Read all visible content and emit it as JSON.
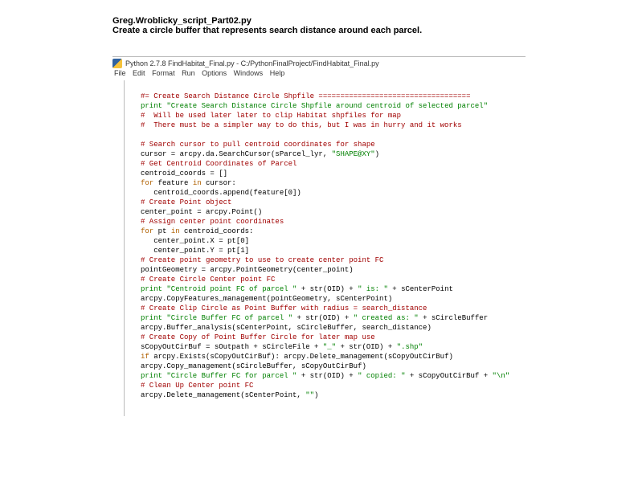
{
  "heading": {
    "filename": "Greg.Wroblicky_script_Part02.py",
    "subtitle": "Create a circle buffer that represents search distance around each parcel."
  },
  "ide": {
    "titlebar": "Python 2.7.8 FindHabitat_Final.py - C:/PythonFinalProject/FindHabitat_Final.py",
    "menu": [
      "File",
      "Edit",
      "Format",
      "Run",
      "Options",
      "Windows",
      "Help"
    ]
  },
  "code_lines": [
    [
      {
        "c": "red",
        "t": "#= Create Search Distance Circle Shpfile ==================================="
      }
    ],
    [
      {
        "c": "green",
        "t": "print "
      },
      {
        "c": "green",
        "t": "\"Create Search Distance Circle Shpfile around centroid of selected parcel\""
      }
    ],
    [
      {
        "c": "red",
        "t": "#  Will be used later later to clip Habitat shpfiles for map"
      }
    ],
    [
      {
        "c": "red",
        "t": "#  There must be a simpler way to do this, but I was in hurry and it works"
      }
    ],
    [],
    [
      {
        "c": "red",
        "t": "# Search cursor to pull centroid coordinates for shape"
      }
    ],
    [
      {
        "c": "black",
        "t": "cursor = arcpy.da.SearchCursor(sParcel_lyr, "
      },
      {
        "c": "green",
        "t": "\"SHAPE@XY\""
      },
      {
        "c": "black",
        "t": ")"
      }
    ],
    [
      {
        "c": "red",
        "t": "# Get Centroid Coordinates of Parcel"
      }
    ],
    [
      {
        "c": "black",
        "t": "centroid_coords = []"
      }
    ],
    [
      {
        "c": "orange",
        "t": "for"
      },
      {
        "c": "black",
        "t": " feature "
      },
      {
        "c": "orange",
        "t": "in"
      },
      {
        "c": "black",
        "t": " cursor:"
      }
    ],
    [
      {
        "c": "black",
        "t": "   centroid_coords.append(feature[0])"
      }
    ],
    [
      {
        "c": "red",
        "t": "# Create Point object"
      }
    ],
    [
      {
        "c": "black",
        "t": "center_point = arcpy.Point()"
      }
    ],
    [
      {
        "c": "red",
        "t": "# Assign center point coordinates"
      }
    ],
    [
      {
        "c": "orange",
        "t": "for"
      },
      {
        "c": "black",
        "t": " pt "
      },
      {
        "c": "orange",
        "t": "in"
      },
      {
        "c": "black",
        "t": " centroid_coords:"
      }
    ],
    [
      {
        "c": "black",
        "t": "   center_point.X = pt[0]"
      }
    ],
    [
      {
        "c": "black",
        "t": "   center_point.Y = pt[1]"
      }
    ],
    [
      {
        "c": "red",
        "t": "# Create point geometry to use to create center point FC"
      }
    ],
    [
      {
        "c": "black",
        "t": "pointGeometry = arcpy.PointGeometry(center_point)"
      }
    ],
    [
      {
        "c": "red",
        "t": "# Create Circle Center point FC"
      }
    ],
    [
      {
        "c": "green",
        "t": "print "
      },
      {
        "c": "green",
        "t": "\"Centroid point FC of parcel \""
      },
      {
        "c": "black",
        "t": " + str(OID) + "
      },
      {
        "c": "green",
        "t": "\" is: \""
      },
      {
        "c": "black",
        "t": " + sCenterPoint"
      }
    ],
    [
      {
        "c": "black",
        "t": "arcpy.CopyFeatures_management(pointGeometry, sCenterPoint)"
      }
    ],
    [
      {
        "c": "red",
        "t": "# Create Clip Circle as Point Buffer with radius = search_distance"
      }
    ],
    [
      {
        "c": "green",
        "t": "print "
      },
      {
        "c": "green",
        "t": "\"Circle Buffer FC of parcel \""
      },
      {
        "c": "black",
        "t": " + str(OID) + "
      },
      {
        "c": "green",
        "t": "\" created as: \""
      },
      {
        "c": "black",
        "t": " + sCircleBuffer"
      }
    ],
    [
      {
        "c": "black",
        "t": "arcpy.Buffer_analysis(sCenterPoint, sCircleBuffer, search_distance)"
      }
    ],
    [
      {
        "c": "red",
        "t": "# Create Copy of Point Buffer Circle for later map use"
      }
    ],
    [
      {
        "c": "black",
        "t": "sCopyOutCirBuf = sOutpath + sCircleFile + "
      },
      {
        "c": "green",
        "t": "\"_\""
      },
      {
        "c": "black",
        "t": " + str(OID) + "
      },
      {
        "c": "green",
        "t": "\".shp\""
      }
    ],
    [
      {
        "c": "orange",
        "t": "if"
      },
      {
        "c": "black",
        "t": " arcpy.Exists(sCopyOutCirBuf): arcpy.Delete_management(sCopyOutCirBuf)"
      }
    ],
    [
      {
        "c": "black",
        "t": "arcpy.Copy_management(sCircleBuffer, sCopyOutCirBuf)"
      }
    ],
    [
      {
        "c": "green",
        "t": "print "
      },
      {
        "c": "green",
        "t": "\"Circle Buffer FC for parcel \""
      },
      {
        "c": "black",
        "t": " + str(OID) + "
      },
      {
        "c": "green",
        "t": "\" copied: \""
      },
      {
        "c": "black",
        "t": " + sCopyOutCirBuf + "
      },
      {
        "c": "green",
        "t": "\"\\n\""
      }
    ],
    [
      {
        "c": "red",
        "t": "# Clean Up Center point FC"
      }
    ],
    [
      {
        "c": "black",
        "t": "arcpy.Delete_management(sCenterPoint, "
      },
      {
        "c": "green",
        "t": "\"\""
      },
      {
        "c": "black",
        "t": ")"
      }
    ]
  ]
}
